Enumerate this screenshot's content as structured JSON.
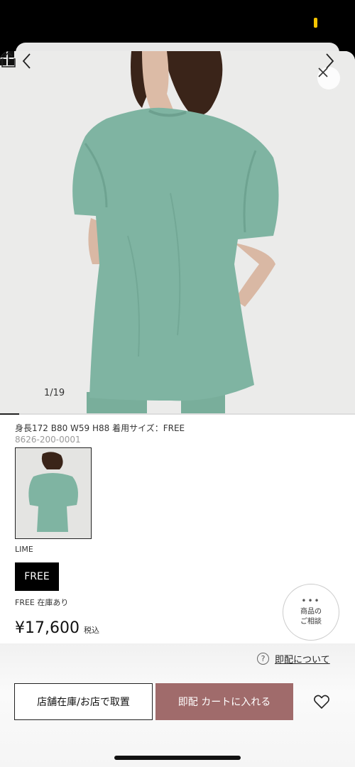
{
  "gallery": {
    "counter": "1/19",
    "progress": 0.053
  },
  "product": {
    "spec": "身長172 B80 W59 H88 着用サイズ：FREE",
    "sku": "8626-200-0001",
    "color_label": "LIME",
    "size_label": "FREE",
    "stock_label": "FREE 在庫あり",
    "price": "¥17,600",
    "tax_label": "税込"
  },
  "consult": {
    "line1": "商品の",
    "line2": "ご相談"
  },
  "actions": {
    "sameday_link": "即配について",
    "store_button": "店舗在庫/お店で取置",
    "cart_button": "即配 カートに入れる"
  },
  "colors": {
    "cart_accent": "#a06b6b",
    "garment": "#7fb4a2"
  },
  "icons": [
    "close-icon",
    "chevron-left-icon",
    "chevron-right-icon",
    "grid-icon",
    "share-icon",
    "help-circle-icon",
    "heart-icon",
    "more-dots-icon"
  ]
}
